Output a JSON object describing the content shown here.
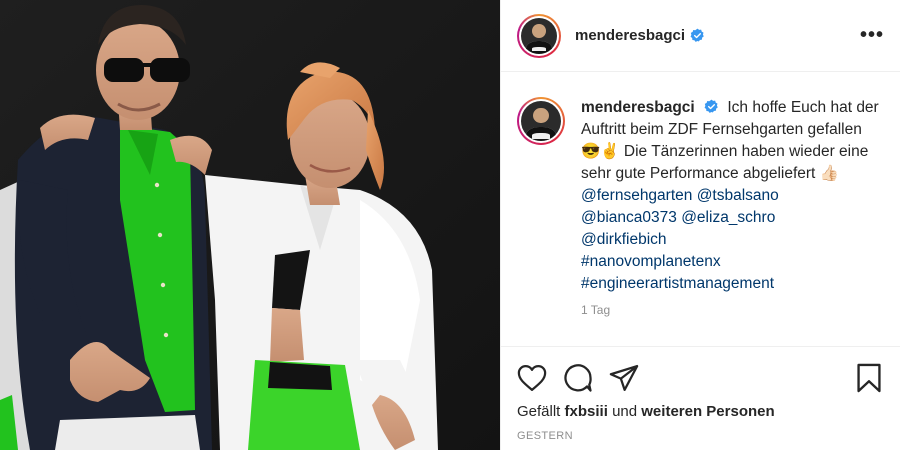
{
  "post": {
    "username": "menderesbagci",
    "caption": {
      "text": "Ich hoffe Euch hat der Auftritt beim ZDF Fernsehgarten gefallen 😎✌️ Die Tänzerinnen haben wieder eine sehr gute Performance abgeliefert 👍🏻",
      "tags": [
        "@fernsehgarten @tsbalsano",
        "@bianca0373 @eliza_schro",
        "@dirkfiebich",
        "#nanovomplanetenx",
        "#engineerartistmanagement"
      ],
      "time": "1 Tag"
    },
    "likes": {
      "prefix": "Gefällt",
      "user": "fxbsiii",
      "connector": "und",
      "others": "weiteren Personen"
    },
    "posted": "GESTERN"
  },
  "icons": {
    "verified": "verified-badge-icon",
    "more": "more-options-icon",
    "like": "heart-icon",
    "comment": "comment-bubble-icon",
    "share": "paper-plane-icon",
    "save": "bookmark-icon"
  },
  "colors": {
    "verified": "#3897f0",
    "link": "#00376b",
    "muted": "#8e8e8e",
    "shirt_green": "#22c21e"
  }
}
